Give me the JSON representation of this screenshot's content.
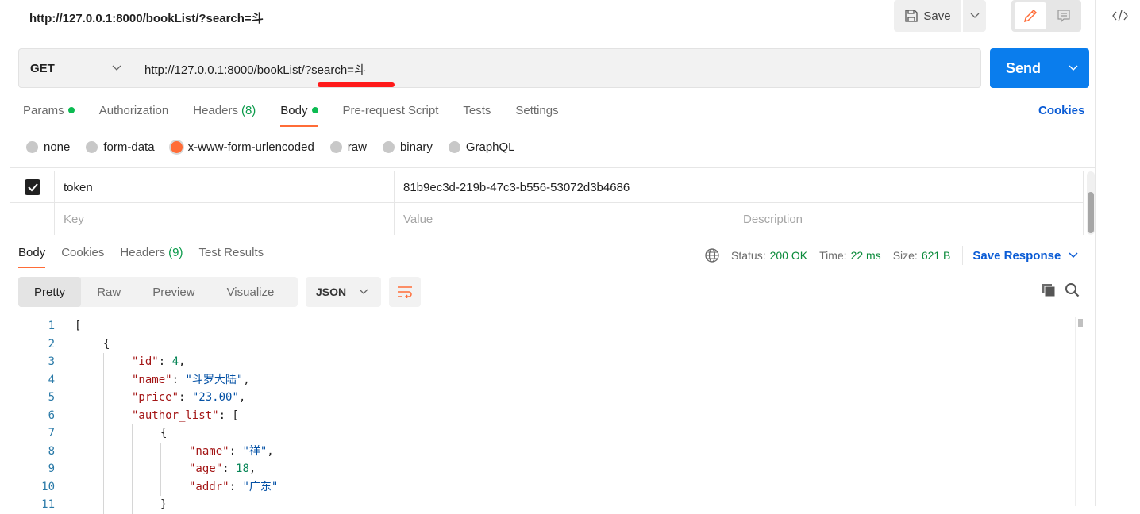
{
  "tab": {
    "title": "http://127.0.0.1:8000/bookList/?search=斗",
    "save_label": "Save"
  },
  "request": {
    "method": "GET",
    "url": "http://127.0.0.1:8000/bookList/?search=斗",
    "send_label": "Send"
  },
  "req_tabs": [
    {
      "label": "Params",
      "dot": true
    },
    {
      "label": "Authorization"
    },
    {
      "label": "Headers",
      "count": "(8)"
    },
    {
      "label": "Body",
      "dot": true,
      "active": true
    },
    {
      "label": "Pre-request Script"
    },
    {
      "label": "Tests"
    },
    {
      "label": "Settings"
    }
  ],
  "cookies_label": "Cookies",
  "body_types": [
    {
      "label": "none"
    },
    {
      "label": "form-data"
    },
    {
      "label": "x-www-form-urlencoded",
      "selected": true
    },
    {
      "label": "raw"
    },
    {
      "label": "binary"
    },
    {
      "label": "GraphQL"
    }
  ],
  "params": {
    "rows": [
      {
        "checked": true,
        "key": "token",
        "value": "81b9ec3d-219b-47c3-b556-53072d3b4686",
        "description": ""
      }
    ],
    "placeholders": {
      "key": "Key",
      "value": "Value",
      "description": "Description"
    }
  },
  "res_tabs": [
    {
      "label": "Body",
      "active": true
    },
    {
      "label": "Cookies"
    },
    {
      "label": "Headers",
      "count": "(9)"
    },
    {
      "label": "Test Results"
    }
  ],
  "response": {
    "status_label": "Status:",
    "status": "200 OK",
    "time_label": "Time:",
    "time": "22 ms",
    "size_label": "Size:",
    "size": "621 B",
    "save_response": "Save Response"
  },
  "views": [
    "Pretty",
    "Raw",
    "Preview",
    "Visualize"
  ],
  "format": "JSON",
  "code": [
    {
      "i": 0,
      "t": [
        [
          "p",
          "["
        ]
      ]
    },
    {
      "i": 1,
      "t": [
        [
          "p",
          "{"
        ]
      ]
    },
    {
      "i": 2,
      "t": [
        [
          "k",
          "\"id\""
        ],
        [
          "p",
          ": "
        ],
        [
          "n",
          "4"
        ],
        [
          "p",
          ","
        ]
      ]
    },
    {
      "i": 2,
      "t": [
        [
          "k",
          "\"name\""
        ],
        [
          "p",
          ": "
        ],
        [
          "s",
          "\"斗罗大陆\""
        ],
        [
          "p",
          ","
        ]
      ]
    },
    {
      "i": 2,
      "t": [
        [
          "k",
          "\"price\""
        ],
        [
          "p",
          ": "
        ],
        [
          "s",
          "\"23.00\""
        ],
        [
          "p",
          ","
        ]
      ]
    },
    {
      "i": 2,
      "t": [
        [
          "k",
          "\"author_list\""
        ],
        [
          "p",
          ": ["
        ]
      ]
    },
    {
      "i": 3,
      "t": [
        [
          "p",
          "{"
        ]
      ]
    },
    {
      "i": 4,
      "t": [
        [
          "k",
          "\"name\""
        ],
        [
          "p",
          ": "
        ],
        [
          "s",
          "\"祥\""
        ],
        [
          "p",
          ","
        ]
      ]
    },
    {
      "i": 4,
      "t": [
        [
          "k",
          "\"age\""
        ],
        [
          "p",
          ": "
        ],
        [
          "n",
          "18"
        ],
        [
          "p",
          ","
        ]
      ]
    },
    {
      "i": 4,
      "t": [
        [
          "k",
          "\"addr\""
        ],
        [
          "p",
          ": "
        ],
        [
          "s",
          "\"广东\""
        ]
      ]
    },
    {
      "i": 3,
      "t": [
        [
          "p",
          "}"
        ]
      ]
    }
  ]
}
